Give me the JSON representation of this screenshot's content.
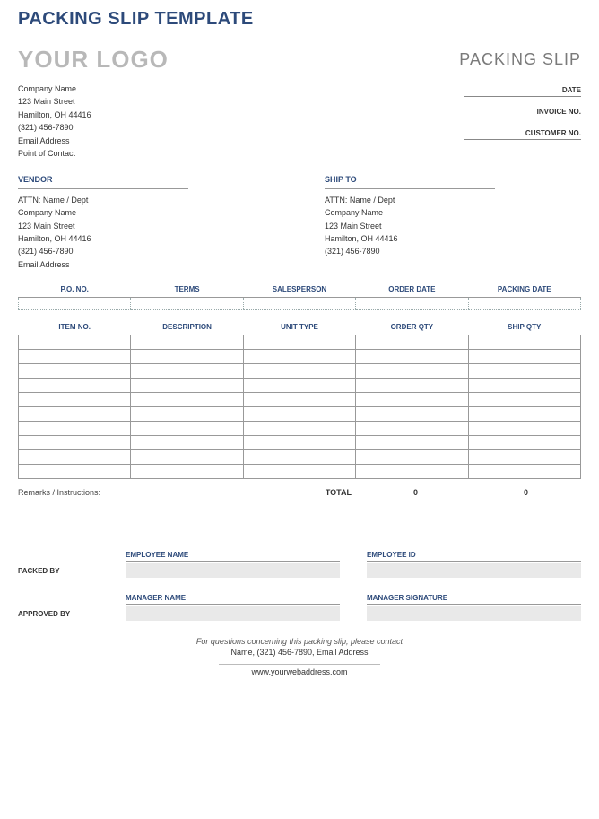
{
  "page_title": "PACKING SLIP TEMPLATE",
  "logo_text": "YOUR LOGO",
  "slip_label": "PACKING SLIP",
  "company": {
    "name": "Company Name",
    "street": "123 Main Street",
    "city": "Hamilton, OH 44416",
    "phone": "(321) 456-7890",
    "email": "Email Address",
    "contact": "Point of Contact"
  },
  "meta_labels": {
    "date": "DATE",
    "invoice_no": "INVOICE NO.",
    "customer_no": "CUSTOMER NO."
  },
  "vendor": {
    "heading": "VENDOR",
    "attn": "ATTN: Name / Dept",
    "company": "Company Name",
    "street": "123 Main Street",
    "city": "Hamilton, OH 44416",
    "phone": "(321) 456-7890",
    "email": "Email Address"
  },
  "ship_to": {
    "heading": "SHIP TO",
    "attn": "ATTN: Name / Dept",
    "company": "Company Name",
    "street": "123 Main Street",
    "city": "Hamilton, OH 44416",
    "phone": "(321) 456-7890"
  },
  "po_headers": {
    "po_no": "P.O. NO.",
    "terms": "TERMS",
    "salesperson": "SALESPERSON",
    "order_date": "ORDER DATE",
    "packing_date": "PACKING DATE"
  },
  "item_headers": {
    "item_no": "ITEM NO.",
    "description": "DESCRIPTION",
    "unit_type": "UNIT TYPE",
    "order_qty": "ORDER QTY",
    "ship_qty": "SHIP QTY"
  },
  "remarks_label": "Remarks / Instructions:",
  "total_label": "TOTAL",
  "total_order_qty": "0",
  "total_ship_qty": "0",
  "sign": {
    "packed_by": "PACKED BY",
    "approved_by": "APPROVED BY",
    "employee_name": "EMPLOYEE NAME",
    "employee_id": "EMPLOYEE ID",
    "manager_name": "MANAGER NAME",
    "manager_signature": "MANAGER SIGNATURE"
  },
  "footer": {
    "line1": "For questions concerning this packing slip, please contact",
    "line2": "Name, (321) 456-7890, Email Address",
    "line3": "www.yourwebaddress.com"
  }
}
